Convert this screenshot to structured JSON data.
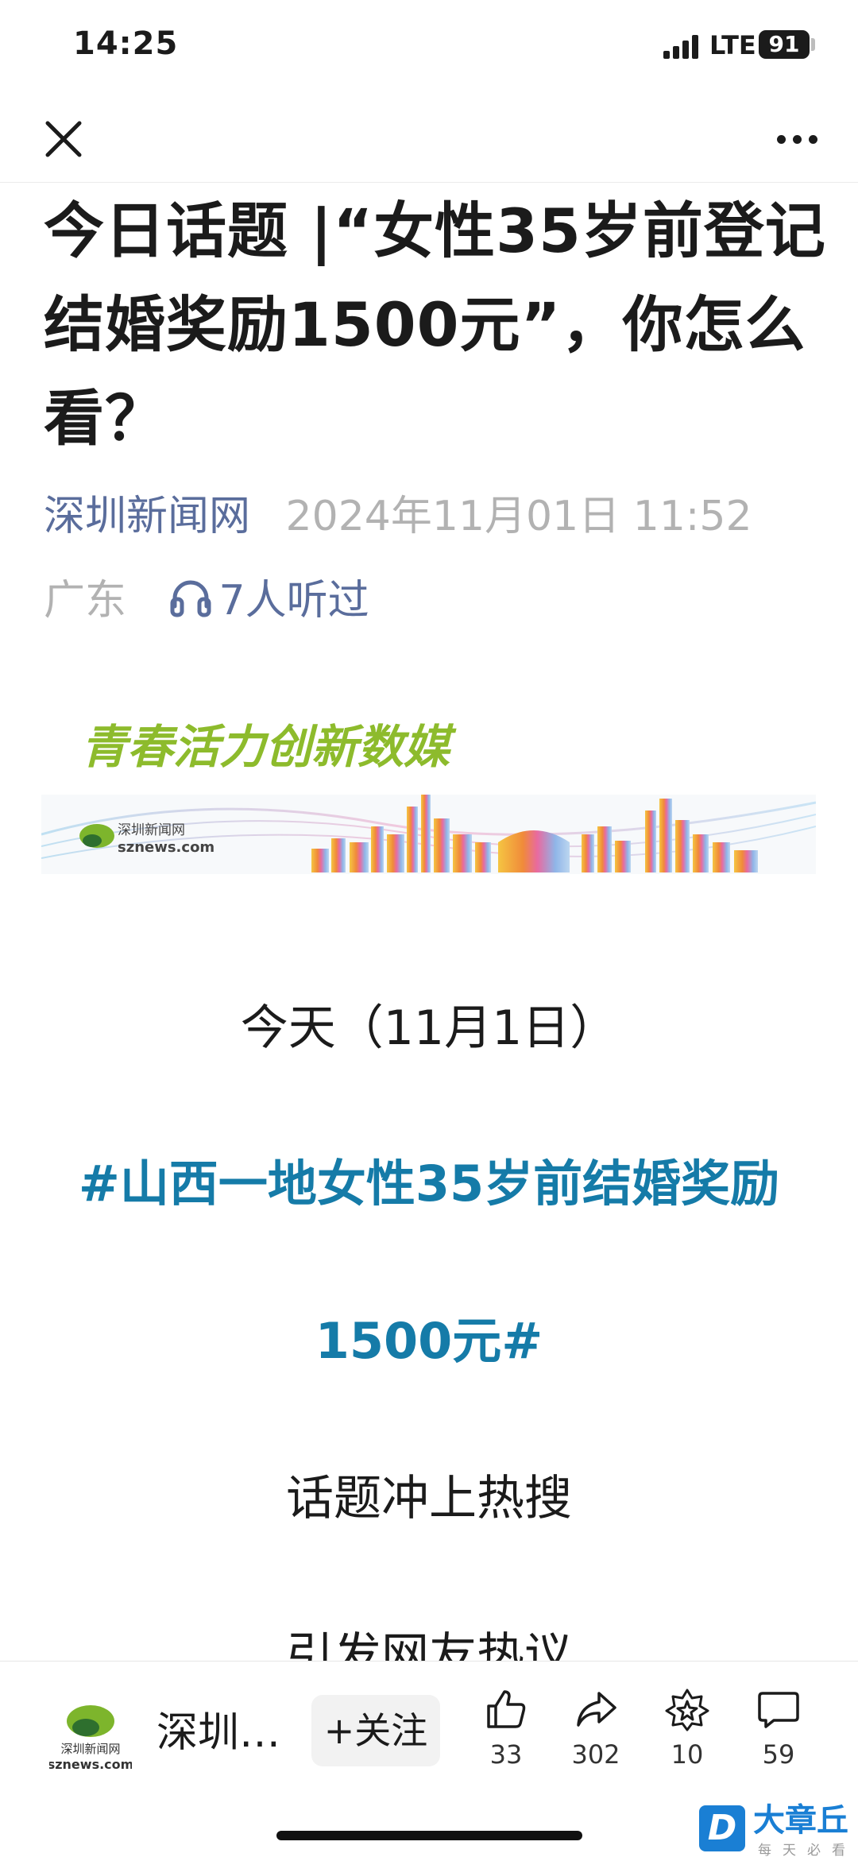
{
  "status_bar": {
    "time": "14:25",
    "network": "LTE",
    "battery": "91"
  },
  "nav": {
    "close_icon": "close-icon",
    "more_icon": "more-icon"
  },
  "article": {
    "title": "今日话题 |“女性35岁前登记结婚奖励1500元”，你怎么看？",
    "source": "深圳新闻网",
    "date": "2024年11月01日 11:52",
    "region": "广东",
    "listen_count": "7人听过",
    "banner": {
      "slogan": "青春活力创新数媒",
      "logo_cn": "深圳新闻网",
      "logo_en": "sznews.com"
    },
    "paragraphs": {
      "p1": "今天（11月1日）",
      "topic_line1": "#山西一地女性35岁前结婚奖励",
      "topic_line2": "1500元#",
      "p2": "话题冲上热搜",
      "p3": "引发网友热议"
    }
  },
  "bottom_bar": {
    "account_name": "深圳…",
    "account_logo_text": "深圳新闻网",
    "account_logo_domain": "sznews.com",
    "follow_label": "+关注",
    "actions": [
      {
        "icon": "thumbs-up-icon",
        "count": "33"
      },
      {
        "icon": "share-icon",
        "count": "302"
      },
      {
        "icon": "star-icon",
        "count": "10"
      },
      {
        "icon": "comment-icon",
        "count": "59"
      }
    ]
  },
  "watermark": {
    "badge": "D",
    "name": "大章丘",
    "slogan": "每天必看"
  },
  "colors": {
    "link": "#5a6d9c",
    "topic": "#157ba8",
    "meta_gray": "#b2b2b2",
    "watermark_blue": "#1a7fd4"
  }
}
